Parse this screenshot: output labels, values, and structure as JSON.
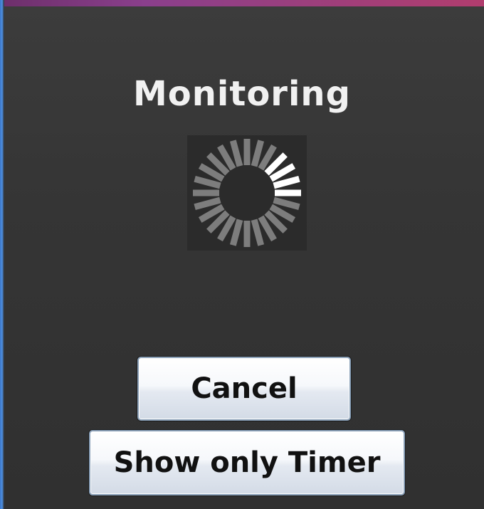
{
  "dialog": {
    "status_title": "Monitoring",
    "spinner": {
      "icon": "loading-spinner-icon",
      "segment_count": 24,
      "highlight_segments": 4,
      "base_color": "#8c8c8c",
      "highlight_color": "#ffffff"
    },
    "buttons": {
      "cancel_label": "Cancel",
      "show_timer_label": "Show only Timer"
    }
  }
}
